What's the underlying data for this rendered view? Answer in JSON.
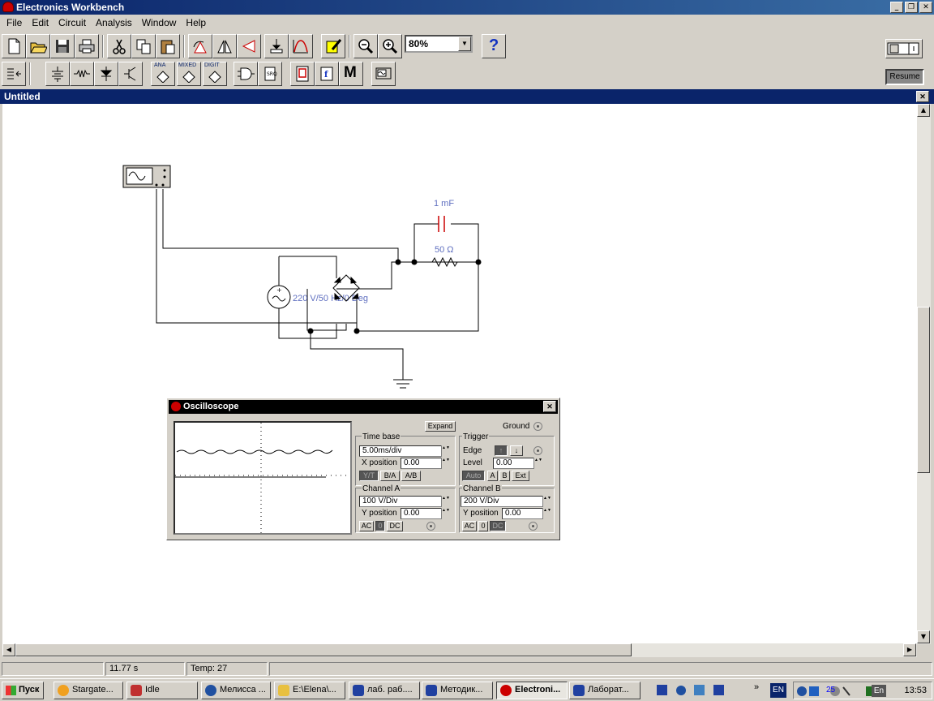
{
  "app": {
    "title": "Electronics Workbench"
  },
  "menu": [
    "File",
    "Edit",
    "Circuit",
    "Analysis",
    "Window",
    "Help"
  ],
  "toolbar": {
    "zoom": "80%",
    "help": "?",
    "multimeter_label": "M",
    "resume": "Resume",
    "ana": "ANA",
    "mixed": "MIXED",
    "digit": "DIGIT"
  },
  "document": {
    "title": "Untitled"
  },
  "circuit": {
    "capacitor_label": "1 mF",
    "resistor_label": "50 Ω",
    "source_label": "220 V/50 Hz/0 Deg"
  },
  "oscilloscope": {
    "title": "Oscilloscope",
    "expand": "Expand",
    "ground": "Ground",
    "time_base": {
      "label": "Time base",
      "value": "5.00ms/div",
      "x_pos_label": "X position",
      "x_pos": "0.00",
      "modes": [
        "Y/T",
        "B/A",
        "A/B"
      ]
    },
    "trigger": {
      "label": "Trigger",
      "edge_label": "Edge",
      "level_label": "Level",
      "level": "0.00",
      "buttons": [
        "Auto",
        "A",
        "B",
        "Ext"
      ]
    },
    "channel_a": {
      "label": "Channel A",
      "value": "100  V/Div",
      "y_pos_label": "Y position",
      "y_pos": "0.00",
      "coupling": [
        "AC",
        "0",
        "DC"
      ]
    },
    "channel_b": {
      "label": "Channel B",
      "value": "200  V/Div",
      "y_pos_label": "Y position",
      "y_pos": "0.00",
      "coupling": [
        "AC",
        "0",
        "DC"
      ]
    }
  },
  "status": {
    "time": "11.77 s",
    "temp": "Temp:  27"
  },
  "taskbar": {
    "start": "Пуск",
    "tasks": [
      "Stargate...",
      "Idle",
      "Мелисса ...",
      "E:\\Elena\\...",
      "лаб. раб....",
      "Методик...",
      "Electroni...",
      "Лаборат..."
    ],
    "lang": "EN",
    "clock": "13:53",
    "tray_num": "25",
    "tray_en": "En"
  }
}
